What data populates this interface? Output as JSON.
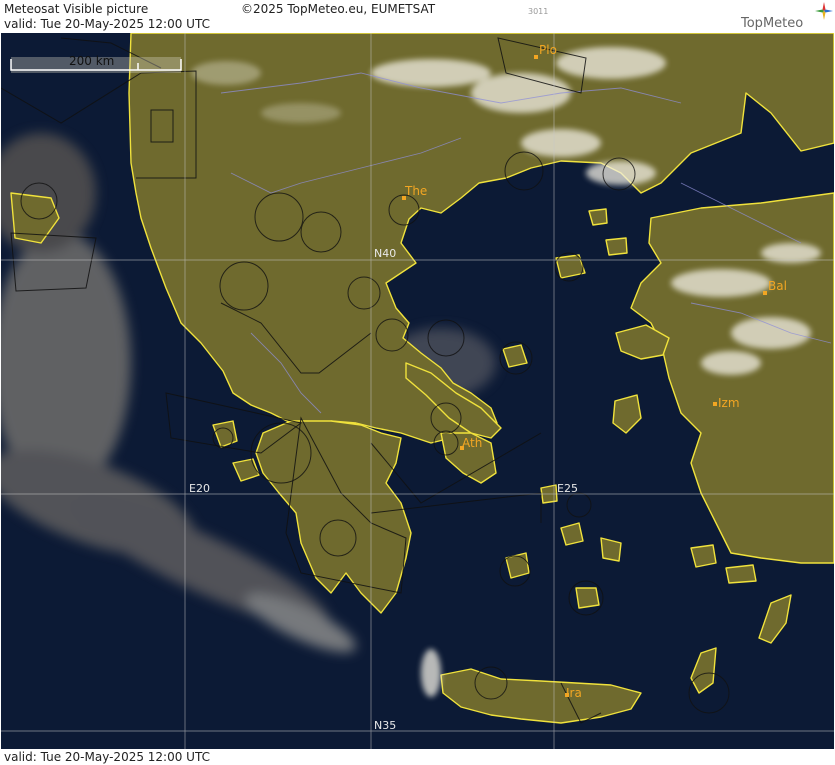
{
  "header": {
    "title": "Meteosat Visible picture",
    "copyright": "©2025 TopMeteo.eu, EUMETSAT",
    "code": "3011",
    "valid": "valid:  Tue  20-May-2025  12:00 UTC",
    "logo": "TopMeteo"
  },
  "footer": {
    "valid": "valid:  Tue  20-May-2025  12:00 UTC"
  },
  "map": {
    "scale_label": "200 km",
    "cities": [
      {
        "label": "Plo"
      },
      {
        "label": "The"
      },
      {
        "label": "Bal"
      },
      {
        "label": "Izm"
      },
      {
        "label": "Ath"
      },
      {
        "label": "Ira"
      }
    ],
    "grid_labels": {
      "n40": "N40",
      "n35": "N35",
      "e20": "E20",
      "e25": "E25"
    },
    "colors": {
      "sea": "#0c1a35",
      "land": "#6f6a2e",
      "coast": "#f0e23c",
      "clouds": "#f2efe4",
      "city": "#f2a623",
      "grid": "#c8c8c8"
    }
  }
}
